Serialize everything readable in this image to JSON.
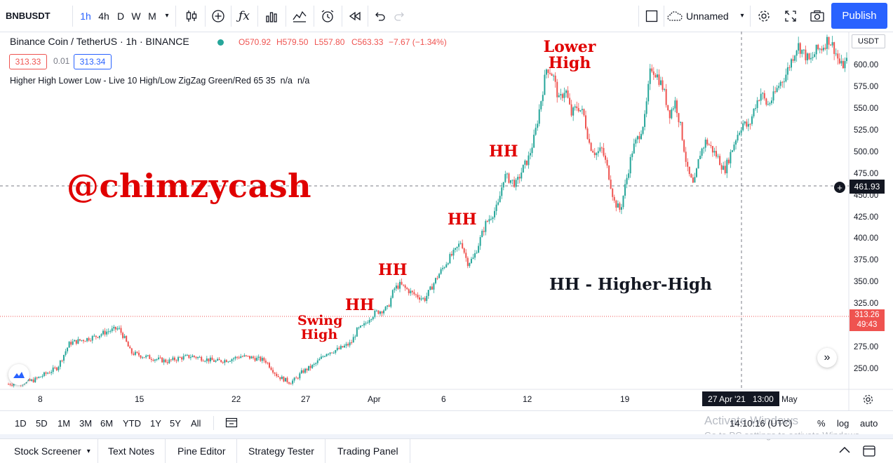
{
  "toolbar": {
    "symbol": "BNBUSDT",
    "intervals": [
      "1h",
      "4h",
      "D",
      "W",
      "M"
    ],
    "layout_name": "Unnamed",
    "publish_label": "Publish"
  },
  "legend": {
    "title": "Binance Coin / TetherUS · 1h · BINANCE",
    "open": "O570.92",
    "high": "H579.50",
    "low": "L557.80",
    "close": "C563.33",
    "change": "−7.67 (−1.34%)",
    "bid": "313.33",
    "spread": "0.01",
    "ask": "313.34",
    "indicator": "Higher High Lower Low - Live 10 High/Low ZigZag Green/Red 65 35  n/a  n/a"
  },
  "price_axis": {
    "currency": "USDT",
    "ticks": [
      "600.00",
      "575.00",
      "550.00",
      "525.00",
      "500.00",
      "475.00",
      "450.00",
      "425.00",
      "400.00",
      "375.00",
      "350.00",
      "325.00",
      "275.00",
      "250.00"
    ],
    "crosshair_price": "461.93",
    "last_price": "313.26",
    "countdown": "49:43"
  },
  "time_axis": {
    "ticks": [
      "8",
      "15",
      "22",
      "27",
      "Apr",
      "6",
      "12",
      "19",
      "May"
    ],
    "crosshair_date": "27 Apr '21",
    "crosshair_time": "13:00"
  },
  "annotations": {
    "watermark": "@chimzycash",
    "swing_high": [
      "Swing",
      "High"
    ],
    "hh": "HH",
    "lower_high": [
      "Lower",
      "High"
    ],
    "legend_text": "HH - Higher-High"
  },
  "ranges": [
    "1D",
    "5D",
    "1M",
    "3M",
    "6M",
    "YTD",
    "1Y",
    "5Y",
    "All"
  ],
  "status": {
    "clock": "14:10:16 (UTC)",
    "percent": "%",
    "log": "log",
    "auto": "auto",
    "activate_title": "Activate Windows",
    "activate_sub": "Go to PC settings to activate Windows."
  },
  "bottom_tabs": [
    "Stock Screener",
    "Text Notes",
    "Pine Editor",
    "Strategy Tester",
    "Trading Panel"
  ],
  "colors": {
    "up": "#26a69a",
    "down": "#ef5350",
    "accent": "#2962ff",
    "annotation": "#e00000"
  },
  "chart_data": {
    "type": "candlestick",
    "title": "Binance Coin / TetherUS · 1h · BINANCE",
    "ylabel": "USDT",
    "ylim": [
      230,
      640
    ],
    "series": [
      {
        "values": [
          [
            2,
            236
          ],
          [
            4,
            240
          ],
          [
            6,
            255
          ],
          [
            7,
            283
          ],
          [
            9,
            290
          ],
          [
            10,
            296
          ],
          [
            11,
            300
          ],
          [
            11.5,
            288
          ],
          [
            12,
            272
          ],
          [
            13,
            268
          ],
          [
            14,
            265
          ],
          [
            15,
            262
          ],
          [
            16,
            266
          ],
          [
            17,
            268
          ],
          [
            18,
            265
          ],
          [
            19,
            262
          ],
          [
            20,
            264
          ],
          [
            21,
            268
          ],
          [
            22,
            266
          ],
          [
            23,
            263
          ],
          [
            24,
            245
          ],
          [
            25,
            238
          ],
          [
            25.5,
            242
          ],
          [
            26,
            250
          ],
          [
            27,
            258
          ],
          [
            28,
            272
          ],
          [
            29,
            276
          ],
          [
            30,
            283
          ],
          [
            30.5,
            298
          ],
          [
            31,
            302
          ],
          [
            31.5,
            312
          ],
          [
            32,
            318
          ],
          [
            33,
            323
          ],
          [
            33.5,
            345
          ],
          [
            34,
            350
          ],
          [
            35,
            340
          ],
          [
            36,
            333
          ],
          [
            36.5,
            345
          ],
          [
            37,
            358
          ],
          [
            38,
            380
          ],
          [
            38.5,
            388
          ],
          [
            39,
            400
          ],
          [
            39.5,
            375
          ],
          [
            40,
            380
          ],
          [
            40.5,
            400
          ],
          [
            41,
            420
          ],
          [
            42,
            440
          ],
          [
            42.5,
            475
          ],
          [
            43,
            470
          ],
          [
            43.5,
            465
          ],
          [
            44,
            482
          ],
          [
            44.5,
            495
          ],
          [
            45,
            520
          ],
          [
            45.5,
            560
          ],
          [
            46,
            600
          ],
          [
            46.5,
            590
          ],
          [
            47,
            560
          ],
          [
            47.5,
            575
          ],
          [
            48,
            545
          ],
          [
            48.5,
            555
          ],
          [
            49,
            545
          ],
          [
            49.5,
            510
          ],
          [
            50,
            500
          ],
          [
            50.5,
            505
          ],
          [
            51,
            480
          ],
          [
            51.5,
            445
          ],
          [
            52,
            435
          ],
          [
            52.5,
            470
          ],
          [
            53,
            505
          ],
          [
            53.5,
            520
          ],
          [
            54,
            540
          ],
          [
            54.5,
            600
          ],
          [
            55,
            590
          ],
          [
            55.5,
            575
          ],
          [
            56,
            545
          ],
          [
            56.5,
            560
          ],
          [
            57,
            525
          ],
          [
            57.5,
            480
          ],
          [
            58,
            462
          ],
          [
            58.5,
            500
          ],
          [
            59,
            515
          ],
          [
            59.5,
            505
          ],
          [
            60,
            495
          ],
          [
            60.5,
            480
          ],
          [
            61,
            500
          ],
          [
            61.5,
            520
          ],
          [
            62,
            535
          ],
          [
            62.5,
            530
          ],
          [
            63,
            555
          ],
          [
            63.5,
            570
          ],
          [
            64,
            555
          ],
          [
            64.5,
            565
          ],
          [
            65,
            580
          ],
          [
            65.5,
            590
          ],
          [
            66,
            608
          ],
          [
            66.5,
            625
          ],
          [
            67,
            615
          ],
          [
            67.5,
            605
          ],
          [
            68,
            618
          ],
          [
            68.5,
            622
          ],
          [
            69,
            632
          ],
          [
            69.5,
            620
          ],
          [
            70,
            600
          ],
          [
            70.5,
            605
          ]
        ]
      }
    ]
  }
}
